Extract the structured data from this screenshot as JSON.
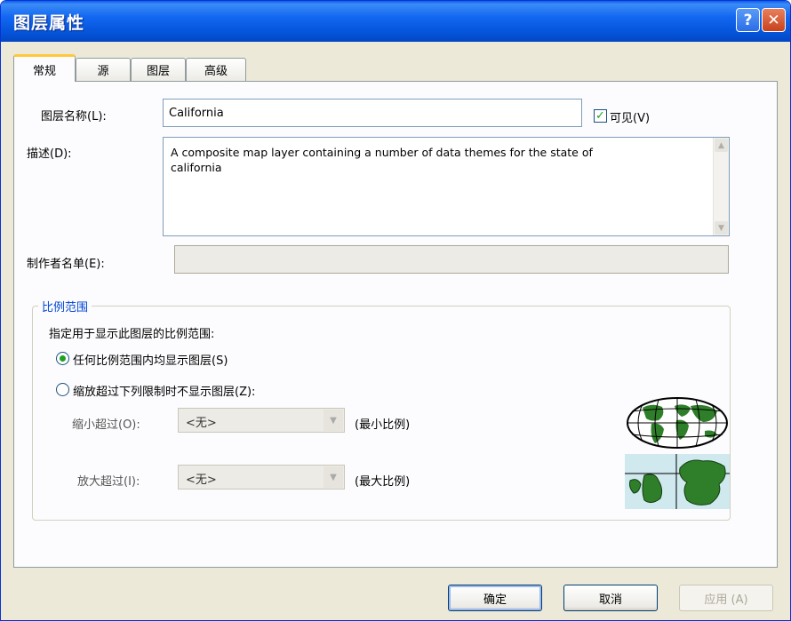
{
  "window": {
    "title": "图层属性",
    "help_glyph": "?",
    "close_glyph": "✕"
  },
  "tabs": [
    {
      "label": "常规",
      "active": true
    },
    {
      "label": "源",
      "active": false
    },
    {
      "label": "图层",
      "active": false
    },
    {
      "label": "高级",
      "active": false
    }
  ],
  "general": {
    "layer_name_label": "图层名称(L):",
    "layer_name_value": "California",
    "visible_label": "可见(V)",
    "visible_checked": true,
    "description_label": "描述(D):",
    "description_value": "A composite map layer containing a number of data themes for the state of california",
    "credits_label": "制作者名单(E):",
    "credits_value": ""
  },
  "scale_range": {
    "group_title": "比例范围",
    "instruction": "指定用于显示此图层的比例范围:",
    "option_all": "任何比例范围内均显示图层(S)",
    "option_limit": "缩放超过下列限制时不显示图层(Z):",
    "selected_option": "all",
    "zoom_out_label": "缩小超过(O):",
    "zoom_out_value": "<无>",
    "zoom_out_suffix": "(最小比例)",
    "zoom_in_label": "放大超过(I):",
    "zoom_in_value": "<无>",
    "zoom_in_suffix": "(最大比例)"
  },
  "buttons": {
    "ok": "确定",
    "cancel": "取消",
    "apply": "应用 (A)"
  },
  "colors": {
    "titlebar": "#0453d8",
    "group_title": "#0046d5",
    "check": "#21a121"
  }
}
